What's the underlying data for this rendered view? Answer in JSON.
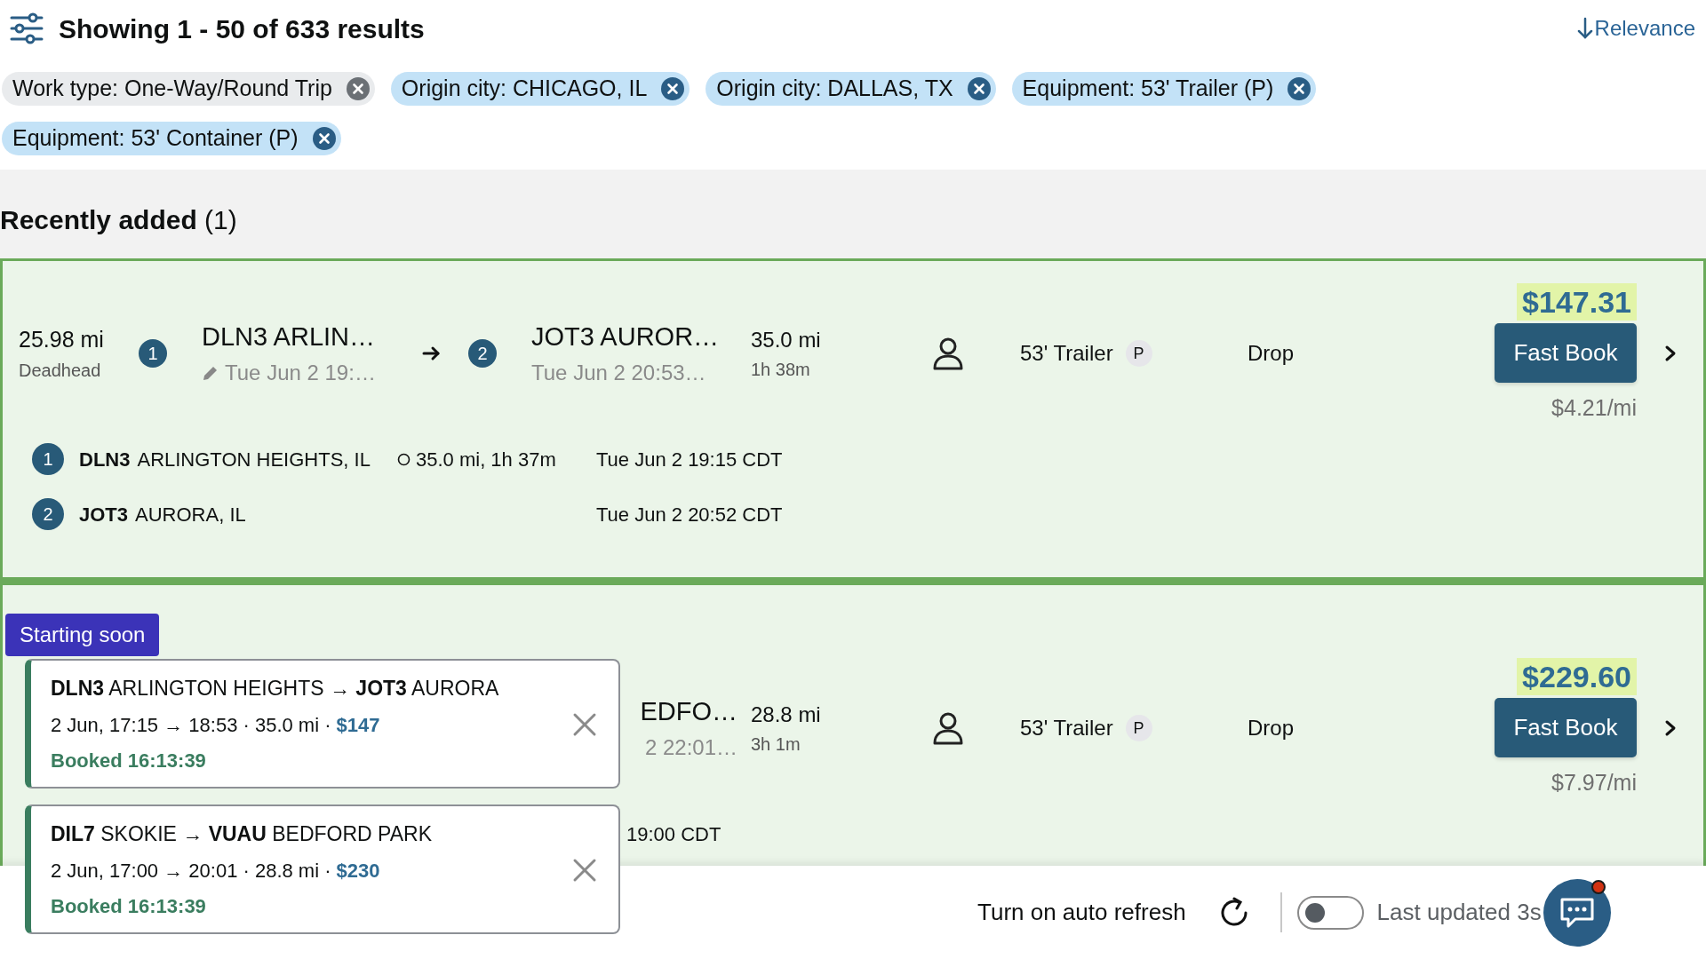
{
  "header": {
    "title": "Showing 1 - 50 of 633 results",
    "sort": "Relevance"
  },
  "filters": [
    {
      "label": "Work type: One-Way/Round Trip",
      "kind": "default"
    },
    {
      "label": "Origin city: CHICAGO, IL",
      "kind": "filter"
    },
    {
      "label": "Origin city: DALLAS, TX",
      "kind": "filter"
    },
    {
      "label": "Equipment: 53' Trailer (P)",
      "kind": "filter"
    },
    {
      "label": "Equipment: 53' Container (P)",
      "kind": "filter"
    }
  ],
  "section": {
    "title": "**Recently added** (1)"
  },
  "loads": [
    {
      "deadhead": {
        "distance": "25.98 mi",
        "label": "Deadhead"
      },
      "origin": {
        "number": "1",
        "name": "DLN3 ARLIN…",
        "time": "Tue Jun 2 19:…",
        "edit_icon": true
      },
      "destination": {
        "number": "2",
        "name": "JOT3 AUROR…",
        "time": "Tue Jun 2 20:53…"
      },
      "trip": {
        "distance": "35.0 mi",
        "duration": "1h 38m"
      },
      "equipment": {
        "name": "53' Trailer",
        "badge": "P"
      },
      "service": "Drop",
      "price": "$147.31",
      "action": "Fast Book",
      "rate": "$4.21/mi",
      "stops": [
        {
          "number": "1",
          "code": "DLN3",
          "city": "ARLINGTON HEIGHTS, IL",
          "leg": "35.0 mi, 1h 37m",
          "time": "Tue Jun 2 19:15 CDT"
        },
        {
          "number": "2",
          "code": "JOT3",
          "city": "AURORA, IL",
          "time": "Tue Jun 2 20:52 CDT"
        }
      ]
    },
    {
      "badge": "Starting soon",
      "destination": {
        "name": "EDFO…",
        "time": "2 22:01…"
      },
      "trip": {
        "distance": "28.8 mi",
        "duration": "3h 1m"
      },
      "equipment": {
        "name": "53' Trailer",
        "badge": "P"
      },
      "service": "Drop",
      "price": "$229.60",
      "action": "Fast Book",
      "rate": "$7.97/mi",
      "stops": [
        {
          "time": "19:00 CDT"
        }
      ]
    }
  ],
  "toasts": [
    {
      "route": "**DLN3** ARLINGTON HEIGHTS → **JOT3** AURORA",
      "details": "2 Jun, 17:15 → 18:53 · 35.0 mi ·",
      "price": "$147",
      "status": "Booked 16:13:39"
    },
    {
      "route": "**DIL7** SKOKIE → **VUAU** BEDFORD PARK",
      "details": "2 Jun, 17:00 → 20:01 · 28.8 mi ·",
      "price": "$230",
      "status": "Booked 16:13:39"
    }
  ],
  "footer": {
    "auto_refresh_label": "Turn on auto refresh",
    "auto_refresh": {
      "on": false
    },
    "last_updated": "Last updated 3s",
    "chat": {
      "unread": true
    }
  }
}
